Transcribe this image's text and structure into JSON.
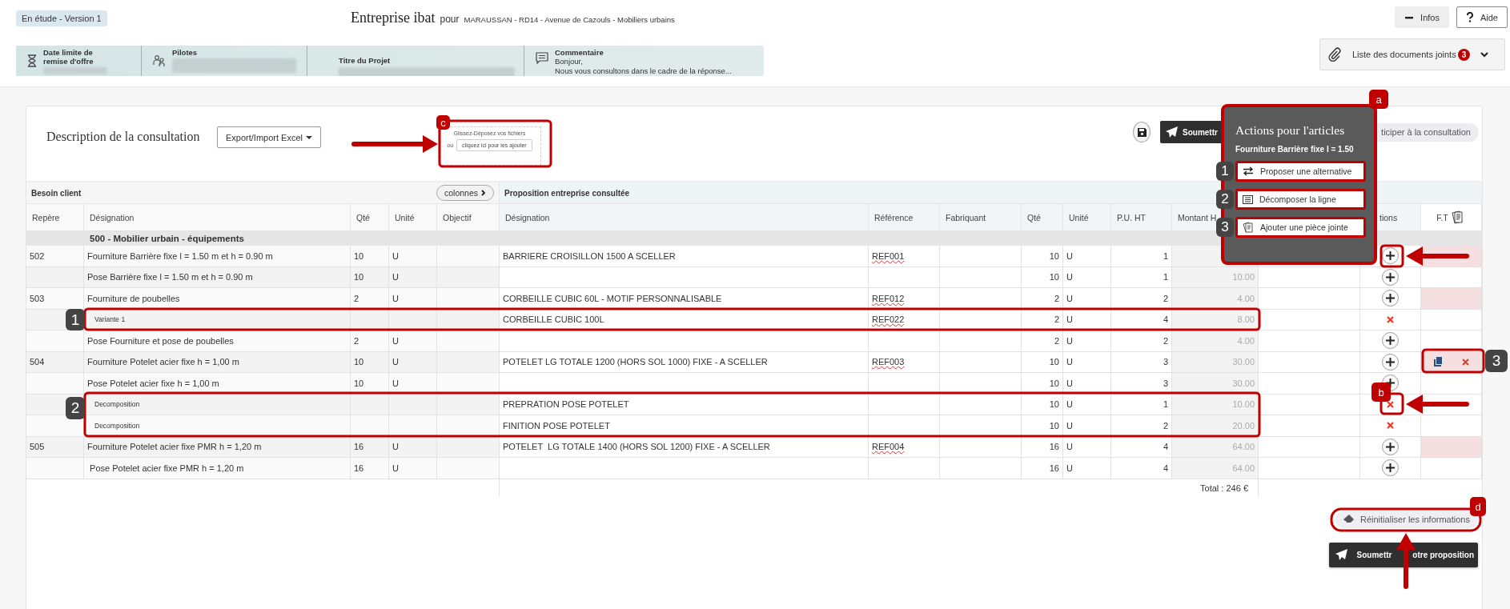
{
  "status_badge": "En étude - Version 1",
  "header": {
    "company": "Entreprise ibat",
    "preposition": "pour",
    "project": "MARAUSSAN - RD14 - Avenue de Cazouls - Mobiliers urbains"
  },
  "top_buttons": [
    {
      "label": "Infos",
      "kind": "collapse"
    },
    {
      "label": "Aide",
      "kind": "help"
    }
  ],
  "info_strip": [
    {
      "label": "Date limite de remise d'offre",
      "kind": "deadline",
      "redacted": true
    },
    {
      "label": "Pilotes",
      "kind": "people",
      "redacted": true
    },
    {
      "label": "Titre du Projet",
      "kind": "plain",
      "redacted": true
    },
    {
      "label": "Commentaire",
      "kind": "comment",
      "lines": [
        "Bonjour,",
        "Nous vous consultons dans le cadre de la réponse..."
      ]
    }
  ],
  "documents": {
    "label": "Liste des documents joints",
    "count": "3"
  },
  "consultation": {
    "title": "Description de la consultation",
    "export_button": "Export/Import Excel",
    "dropzone": {
      "hint": "Glissez-Déposez vos fichiers",
      "or": "ou",
      "button": "cliquez ici pour les ajouter"
    },
    "submit_button": "Soumettr",
    "participate_button": "ticiper à la consultation"
  },
  "actions_popup": {
    "title": "Actions pour l'articles",
    "subtitle": "Fourniture Barrière fixe l = 1.50",
    "items": [
      {
        "step": "1",
        "label": "Proposer une alternative",
        "kind": "swap"
      },
      {
        "step": "2",
        "label": "Décomposer la ligne",
        "kind": "list"
      },
      {
        "step": "3",
        "label": "Ajouter une pièce jointe",
        "kind": "attach"
      }
    ]
  },
  "table": {
    "groups": [
      {
        "label": "Besoin client",
        "button": "colonnes"
      },
      {
        "label": "Proposition entreprise consultée"
      }
    ],
    "columns": [
      "Repère",
      "Désignation",
      "Qté",
      "Unité",
      "Objectif",
      "Désignation",
      "Référence",
      "Fabriquant",
      "Qté",
      "Unité",
      "P.U. HT",
      "Montant H",
      "",
      "tions",
      "F.T"
    ],
    "section": "500 - Mobilier urbain - équipements",
    "rows": [
      {
        "kind": "item",
        "repere": "502",
        "designation": "Fourniture Barrière fixe l = 1.50 m et h = 0.90 m",
        "qte": "10",
        "unite": "U",
        "offer": {
          "designation": "BARRIERE CROISILLON 1500 A SCELLER",
          "reference": "REF001",
          "qte": "10",
          "unite": "U",
          "pu": "1"
        },
        "removable": false,
        "ft_highlighted": true,
        "attached": false
      },
      {
        "kind": "item",
        "designation": "Pose Barrière fixe l = 1.50 m et h = 0.90 m",
        "qte": "10",
        "unite": "U",
        "offer": {
          "qte": "10",
          "unite": "U",
          "pu": "1",
          "montant": "10.00"
        },
        "removable": false,
        "ft_highlighted": false,
        "attached": false
      },
      {
        "kind": "item",
        "repere": "503",
        "designation": "Fourniture de poubelles",
        "qte": "2",
        "unite": "U",
        "offer": {
          "designation": "CORBEILLE CUBIC 60L - MOTIF PERSONNALISABLE",
          "reference": "REF012",
          "qte": "2",
          "unite": "U",
          "pu": "2",
          "montant": "4.00"
        },
        "removable": false,
        "ft_highlighted": true,
        "attached": false
      },
      {
        "kind": "sub",
        "designation": "Variante 1",
        "offer": {
          "designation": "CORBEILLE CUBIC 100L",
          "reference": "REF022",
          "qte": "2",
          "unite": "U",
          "pu": "4",
          "montant": "8.00"
        },
        "removable": true,
        "ft_highlighted": false,
        "attached": false
      },
      {
        "kind": "item",
        "designation": "Pose Fourniture et pose de poubelles",
        "qte": "2",
        "unite": "U",
        "offer": {
          "qte": "2",
          "unite": "U",
          "pu": "2",
          "montant": "4.00"
        },
        "removable": false,
        "ft_highlighted": false,
        "attached": false
      },
      {
        "kind": "item",
        "repere": "504",
        "designation": "Fourniture Potelet acier fixe h = 1,00 m",
        "qte": "10",
        "unite": "U",
        "offer": {
          "designation": "POTELET LG TOTALE 1200 (HORS SOL 1000) FIXE - A SCELLER",
          "reference": "REF003",
          "qte": "10",
          "unite": "U",
          "pu": "3",
          "montant": "30.00"
        },
        "removable": false,
        "ft_highlighted": true,
        "attached": true
      },
      {
        "kind": "item",
        "designation": "Pose Potelet acier fixe h = 1,00 m",
        "qte": "10",
        "unite": "U",
        "offer": {
          "qte": "10",
          "unite": "U",
          "pu": "3",
          "montant": "30.00"
        },
        "removable": false,
        "ft_highlighted": false,
        "attached": false
      },
      {
        "kind": "sub",
        "designation": "Decomposition",
        "offer": {
          "designation": "PREPRATION POSE POTELET",
          "qte": "10",
          "unite": "U",
          "pu": "1",
          "montant": "10.00"
        },
        "removable": true,
        "ft_highlighted": false,
        "attached": false
      },
      {
        "kind": "sub",
        "designation": "Decomposition",
        "offer": {
          "designation": "FINITION POSE POTELET",
          "qte": "10",
          "unite": "U",
          "pu": "2",
          "montant": "20.00"
        },
        "removable": true,
        "ft_highlighted": false,
        "attached": false
      },
      {
        "kind": "item",
        "repere": "505",
        "designation": "Fourniture Potelet acier fixe PMR h = 1,20 m",
        "qte": "16",
        "unite": "U",
        "offer": {
          "designation": "POTELET  LG TOTALE 1400 (HORS SOL 1200) FIXE - A SCELLER",
          "reference": "REF004",
          "qte": "16",
          "unite": "U",
          "pu": "4",
          "montant": "64.00"
        },
        "removable": false,
        "ft_highlighted": true,
        "attached": false
      },
      {
        "kind": "item",
        "designation": " Pose Potelet acier fixe PMR h = 1,20 m",
        "qte": "16",
        "unite": "U",
        "offer": {
          "qte": "16",
          "unite": "U",
          "pu": "4",
          "montant": "64.00"
        },
        "removable": false,
        "ft_highlighted": false,
        "attached": false
      }
    ],
    "total": "Total : 246 €"
  },
  "reset_button": "Réinitialiser les informations",
  "submit_proposal_parts": [
    "Soumettr",
    "otre proposition"
  ],
  "markers": [
    {
      "label": "a",
      "kind": "letter"
    },
    {
      "label": "c",
      "kind": "letter"
    },
    {
      "label": "1",
      "kind": "step"
    },
    {
      "label": "3",
      "kind": "step"
    },
    {
      "label": "b",
      "kind": "letter"
    },
    {
      "label": "2",
      "kind": "step"
    },
    {
      "label": "d",
      "kind": "letter"
    }
  ]
}
